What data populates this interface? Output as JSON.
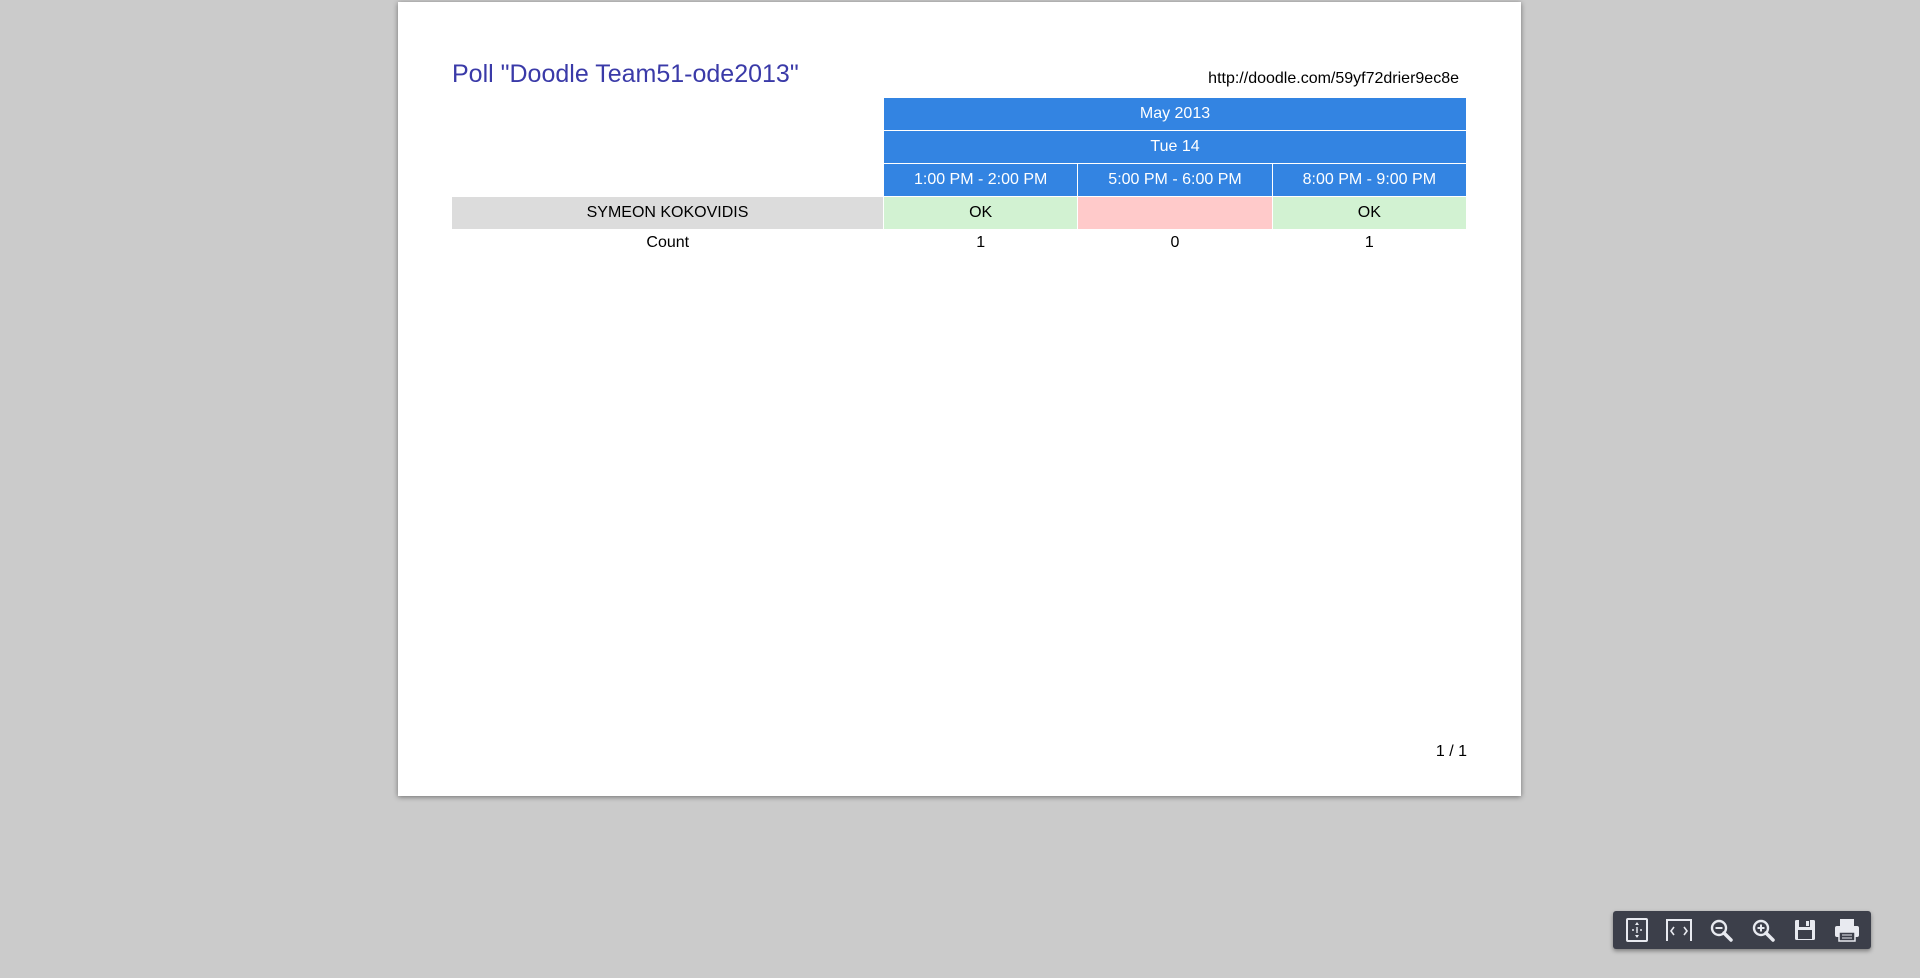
{
  "poll": {
    "title": "Poll \"Doodle Team51-ode2013\"",
    "url": "http://doodle.com/59yf72drier9ec8e",
    "month": "May 2013",
    "day": "Tue 14",
    "slots": [
      "1:00 PM - 2:00 PM",
      "5:00 PM - 6:00 PM",
      "8:00 PM - 9:00 PM"
    ],
    "participant": {
      "name": "SYMEON KOKOVIDIS",
      "responses": [
        "OK",
        "",
        "OK"
      ]
    },
    "count_label": "Count",
    "counts": [
      "1",
      "0",
      "1"
    ]
  },
  "page_number": "1 / 1",
  "colors": {
    "header_blue": "#3384e2",
    "ok_green": "#d2f2d2",
    "no_red": "#ffcaca",
    "title_blue": "#3a3aa8"
  },
  "toolbar": {
    "icons": [
      "fit-page-icon",
      "fit-width-icon",
      "zoom-out-icon",
      "zoom-in-icon",
      "save-icon",
      "print-icon"
    ]
  }
}
